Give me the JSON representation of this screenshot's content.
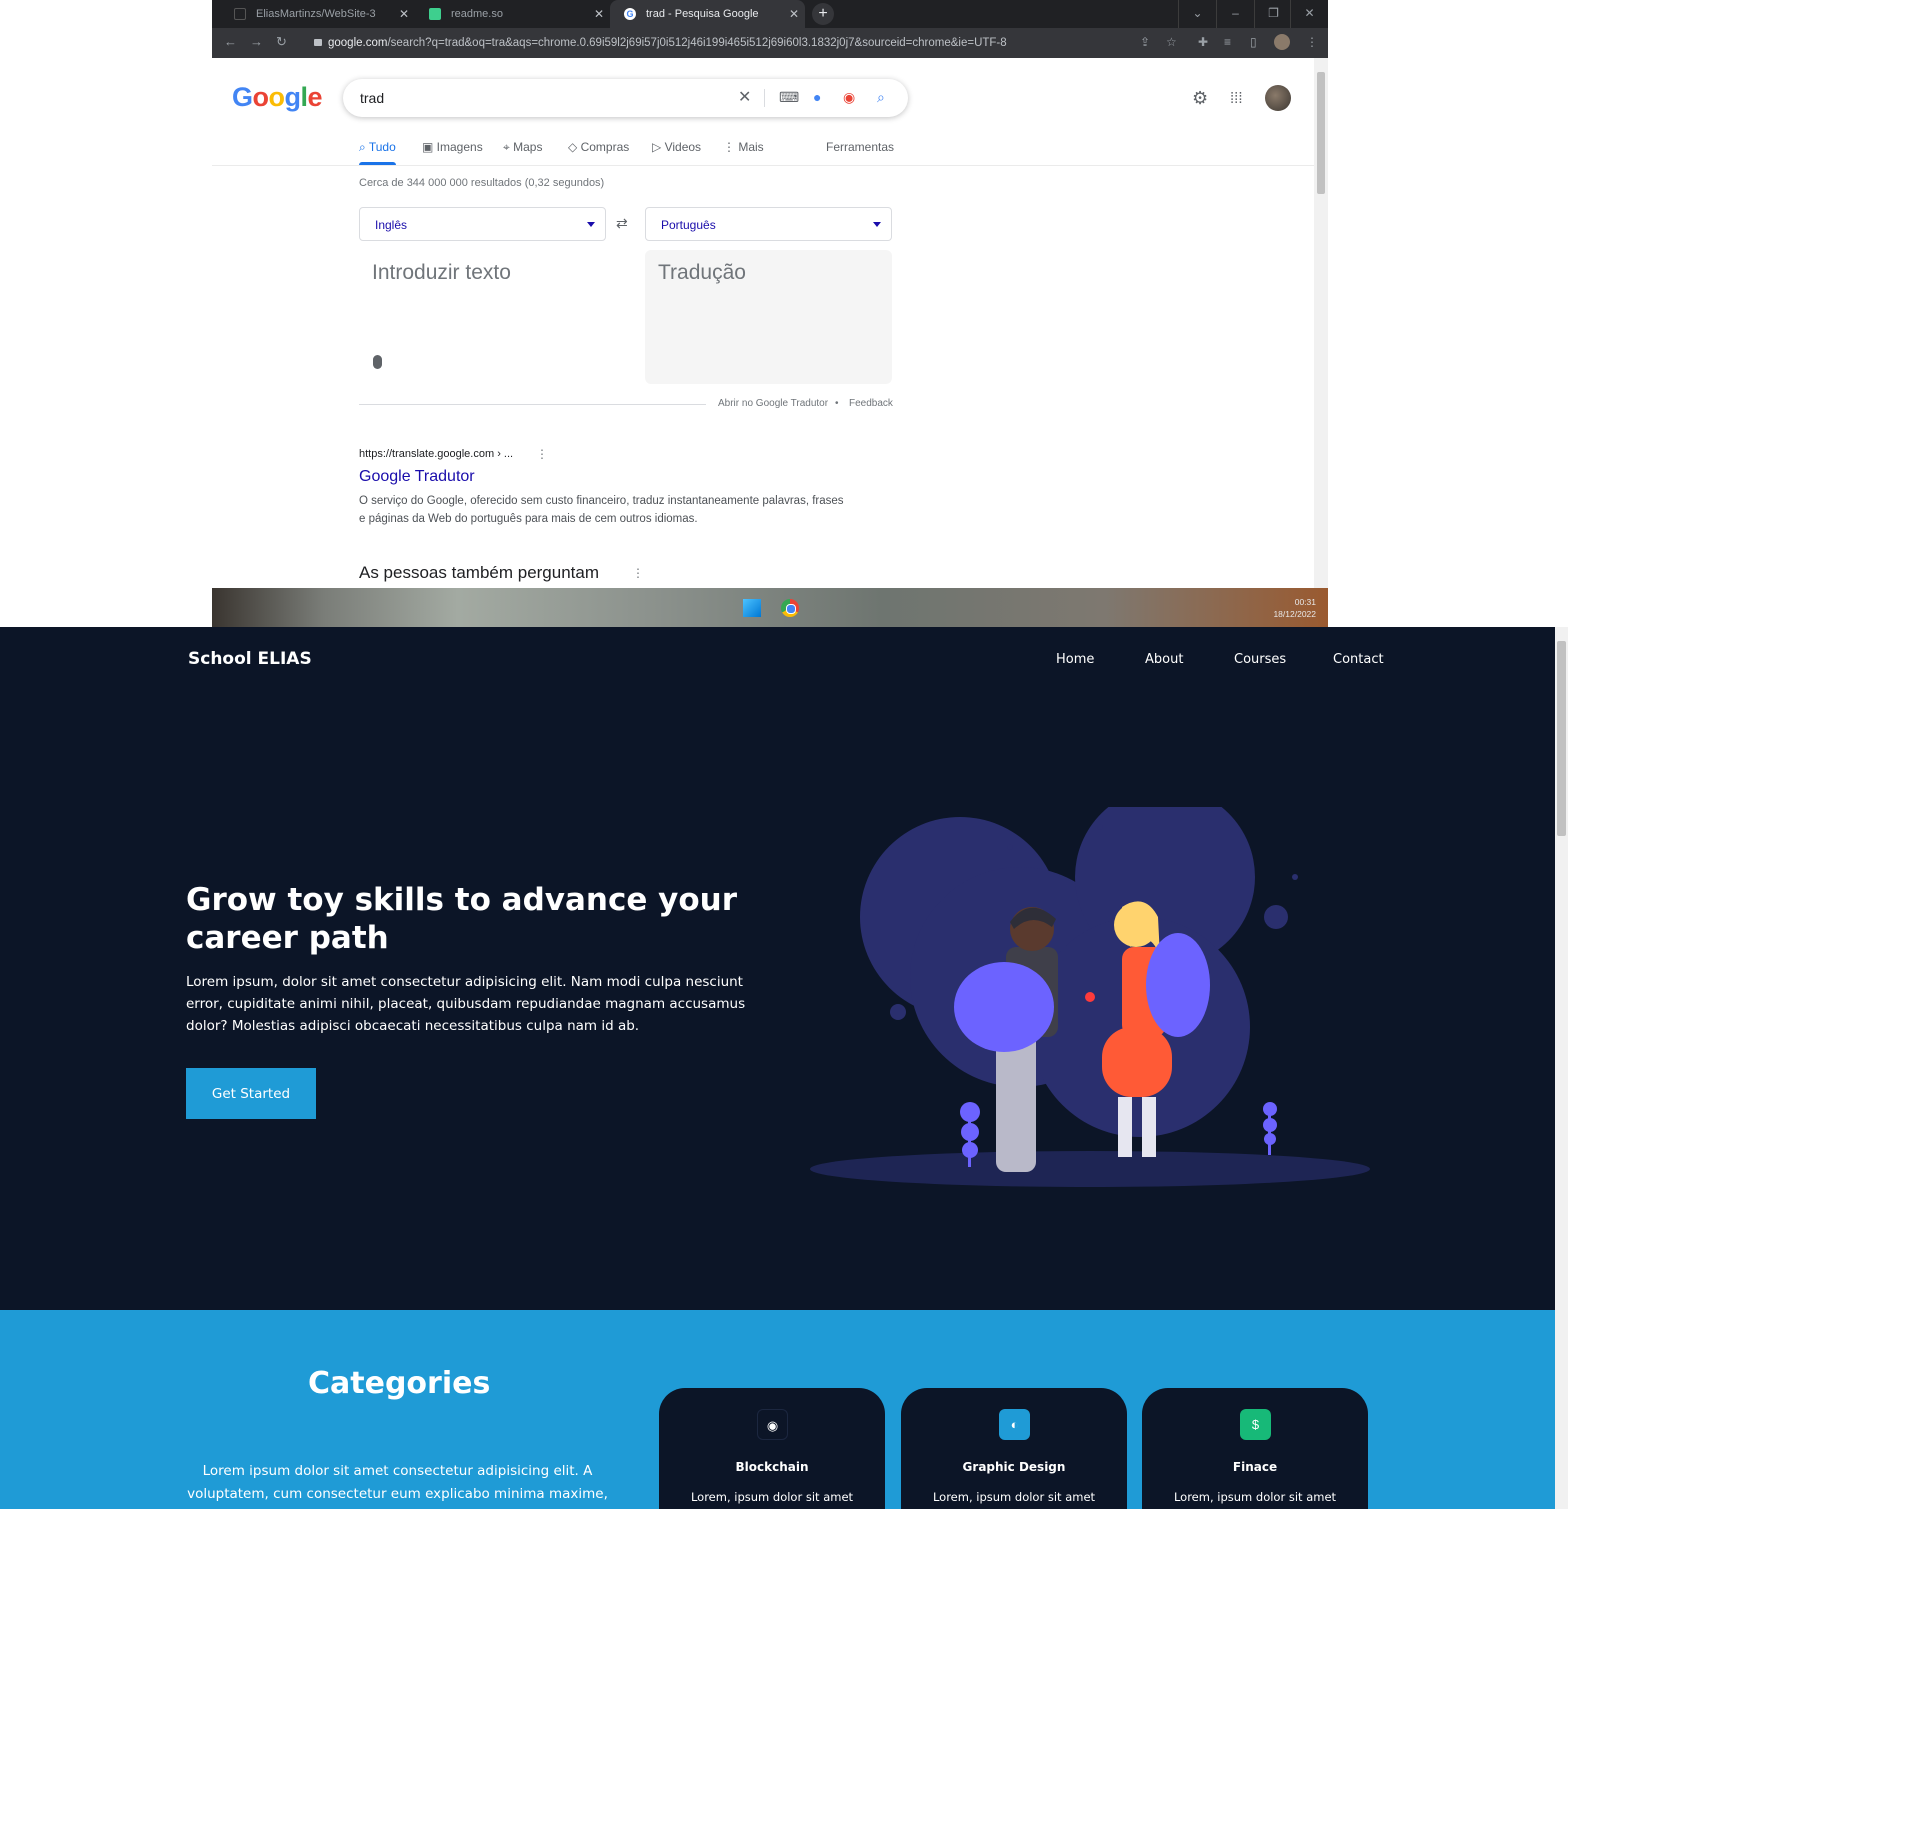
{
  "browser": {
    "tabs": [
      {
        "title": "EliasMartinzs/WebSite-3"
      },
      {
        "title": "readme.so"
      },
      {
        "title": "trad - Pesquisa Google"
      }
    ],
    "new_tab": "+",
    "url_host": "google.com",
    "url_rest": "/search?q=trad&oq=tra&aqs=chrome.0.69i59l2j69i57j0i512j46i199i465i512j69i60l3.1832j0j7&sourceid=chrome&ie=UTF-8"
  },
  "google": {
    "logo": "Google",
    "query": "trad",
    "tabs": [
      "Tudo",
      "Imagens",
      "Maps",
      "Compras",
      "Videos",
      "Mais"
    ],
    "tools": "Ferramentas",
    "stats": "Cerca de 344 000 000 resultados (0,32 segundos)",
    "translator": {
      "source_lang": "Inglês",
      "target_lang": "Português",
      "source_placeholder": "Introduzir texto",
      "target_placeholder": "Tradução",
      "open_link": "Abrir no Google Tradutor",
      "separator": "•",
      "feedback": "Feedback"
    },
    "result": {
      "url": "https://translate.google.com › ...",
      "title": "Google Tradutor",
      "snippet": "O serviço do Google, oferecido sem custo financeiro, traduz instantaneamente palavras, frases e páginas da Web do português para mais de cem outros idiomas."
    },
    "paa": "As pessoas também perguntam"
  },
  "taskbar": {
    "time": "00:31",
    "date": "18/12/2022"
  },
  "site": {
    "brand": "School ELIAS",
    "nav": [
      "Home",
      "About",
      "Courses",
      "Contact"
    ],
    "hero": {
      "title": "Grow toy skills to advance your career path",
      "text": "Lorem ipsum, dolor sit amet consectetur adipisicing elit. Nam modi culpa nesciunt error, cupiditate animi nihil, placeat, quibusdam repudiandae magnam accusamus dolor? Molestias adipisci obcaecati necessitatibus culpa nam id ab.",
      "cta": "Get Started"
    },
    "categories": {
      "title": "Categories",
      "text": "Lorem ipsum dolor sit amet consectetur adipisicing elit. A voluptatem, cum consectetur eum explicabo minima maxime,",
      "cards": [
        {
          "title": "Blockchain",
          "text": "Lorem, ipsum dolor sit amet",
          "color": "#0c1527",
          "icon": "blockchain-icon"
        },
        {
          "title": "Graphic Design",
          "text": "Lorem, ipsum dolor sit amet",
          "color": "#1f9bd6",
          "icon": "palette-icon"
        },
        {
          "title": "Finace",
          "text": "Lorem, ipsum dolor sit amet",
          "color": "#17b978",
          "icon": "dollar-icon"
        }
      ]
    }
  },
  "colors": {
    "hero_bg": "#0c1527",
    "accent": "#1f9bd6",
    "google_blue": "#1a73e8",
    "link": "#1a0dab"
  }
}
